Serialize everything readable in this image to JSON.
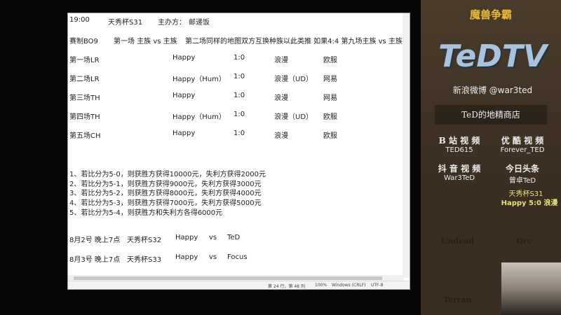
{
  "notepad": {
    "header": {
      "time": "19:00",
      "cup": "天秀杯S31",
      "host_label": "主办方：",
      "host": "邮递饭"
    },
    "format": {
      "label": "赛制BO9",
      "rule1": "第一场 主族 vs 主族",
      "rule2": "第二场同样的地图双方互换种族以此类推 如果4:4 第九场主族 vs 主族"
    },
    "games": [
      {
        "game": "第一场LR",
        "p1": "Happy",
        "score": "1:0",
        "p2": "浪漫",
        "server": "欧服"
      },
      {
        "game": "第二场LR",
        "p1": "Happy（Hum）",
        "score": "1:0",
        "p2": "浪漫（UD）",
        "server": "网易"
      },
      {
        "game": "第三场TH",
        "p1": "Happy",
        "score": "1:0",
        "p2": "浪漫",
        "server": "网易"
      },
      {
        "game": "第四场TH",
        "p1": "Happy（Hum）",
        "score": "1:0",
        "p2": "浪漫（UD）",
        "server": "欧服"
      },
      {
        "game": "第五场CH",
        "p1": "Happy",
        "score": "1:0",
        "p2": "浪漫",
        "server": "欧服"
      }
    ],
    "prizes": [
      "1、若比分为5-0，则获胜方获得10000元，失利方获得2000元",
      "2、若比分为5-1，则获胜方获得9000元，失利方获得3000元",
      "3、若比分为5-2，则获胜方获得8000元，失利方获得4000元",
      "4、若比分为5-3，则获胜方获得7000元，失利方获得5000元",
      "5、若比分为5-4，则获胜方和失利方各得6000元"
    ],
    "schedule": [
      {
        "date": "8月2号 晚上7点",
        "cup": "天秀杯S32",
        "p1": "Happy",
        "vs": "vs",
        "p2": "TeD"
      },
      {
        "date": "8月3号 晚上7点",
        "cup": "天秀杯S33",
        "p1": "Happy",
        "vs": "vs",
        "p2": "Focus"
      }
    ],
    "status": {
      "position": "第 24 行，第 48 列",
      "zoom": "100%",
      "eol": "Windows (CRLF)",
      "encoding": "UTF-8"
    }
  },
  "panel": {
    "game_logo": "魔兽争霸",
    "brand": "TeDTV",
    "weibo": "新浪微博 @war3ted",
    "shop": "TeD的地精商店",
    "links": [
      {
        "title": "B 站 视 频",
        "id": "TED615"
      },
      {
        "title": "优 酷 视 频",
        "id": "Forever_TED"
      },
      {
        "title": "抖 音 视 频",
        "id": "War3TeD"
      },
      {
        "title": "今日头条",
        "id": "曾卓TeD"
      }
    ],
    "overlay_line1": "天秀杯S31",
    "overlay_line2": "Happy 5:0 浪漫",
    "races": [
      "Undead",
      "Orc",
      "Terran"
    ]
  }
}
